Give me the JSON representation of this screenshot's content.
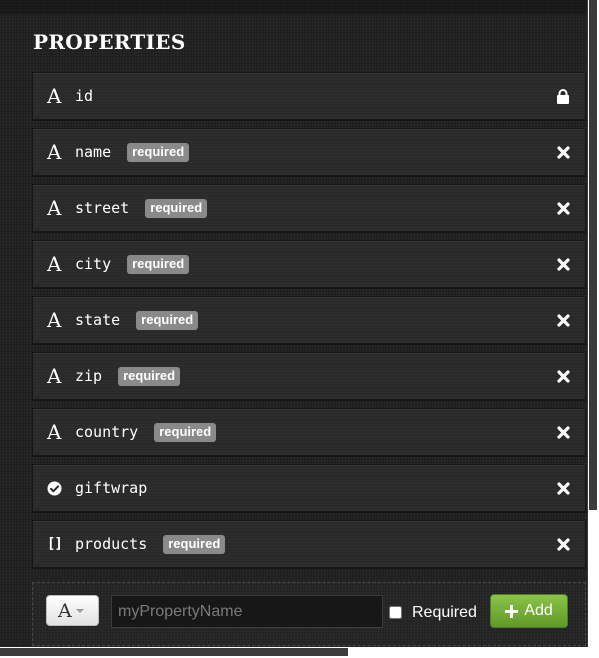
{
  "section": {
    "title": "PROPERTIES"
  },
  "properties": [
    {
      "name": "id",
      "type_icon": "string-type-icon",
      "type_glyph": "A",
      "required": false,
      "action_icon": "lock-icon"
    },
    {
      "name": "name",
      "type_icon": "string-type-icon",
      "type_glyph": "A",
      "required": true,
      "action_icon": "remove-icon"
    },
    {
      "name": "street",
      "type_icon": "string-type-icon",
      "type_glyph": "A",
      "required": true,
      "action_icon": "remove-icon"
    },
    {
      "name": "city",
      "type_icon": "string-type-icon",
      "type_glyph": "A",
      "required": true,
      "action_icon": "remove-icon"
    },
    {
      "name": "state",
      "type_icon": "string-type-icon",
      "type_glyph": "A",
      "required": true,
      "action_icon": "remove-icon"
    },
    {
      "name": "zip",
      "type_icon": "string-type-icon",
      "type_glyph": "A",
      "required": true,
      "action_icon": "remove-icon"
    },
    {
      "name": "country",
      "type_icon": "string-type-icon",
      "type_glyph": "A",
      "required": true,
      "action_icon": "remove-icon"
    },
    {
      "name": "giftwrap",
      "type_icon": "boolean-type-icon",
      "type_glyph": "",
      "required": false,
      "action_icon": "remove-icon"
    },
    {
      "name": "products",
      "type_icon": "array-type-icon",
      "type_glyph": "[]",
      "required": true,
      "action_icon": "remove-icon"
    }
  ],
  "badge": {
    "required_label": "required"
  },
  "add_form": {
    "type_select_value": "A",
    "name_input_value": "",
    "name_input_placeholder": "myPropertyName",
    "required_label": "Required",
    "required_checked": false,
    "add_button_label": "Add",
    "add_button_icon": "plus-icon"
  },
  "colors": {
    "panel_background": "#1f1f1f",
    "row_background": "#2a2a2a",
    "badge_background": "#8a8a8a",
    "add_button": "#6aa832"
  }
}
